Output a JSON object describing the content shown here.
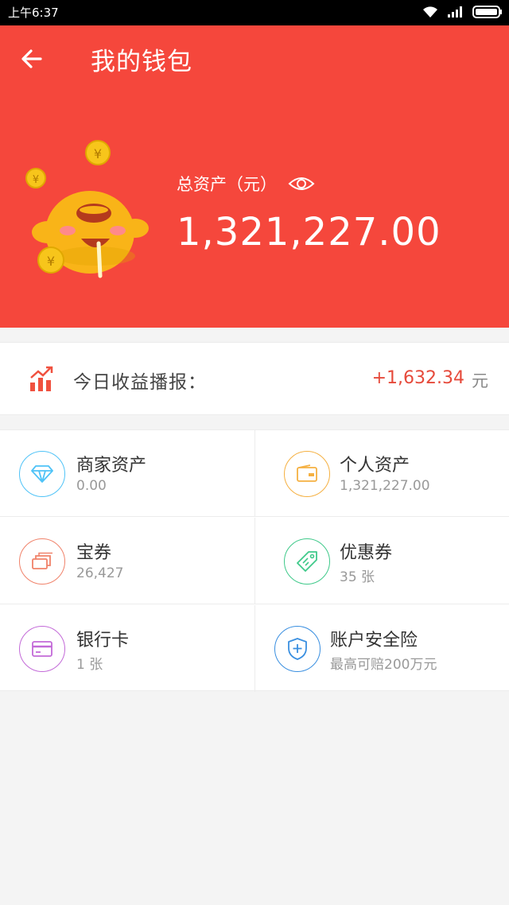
{
  "status_bar": {
    "time": "上午6:37"
  },
  "header": {
    "title": "我的钱包",
    "total_assets_label": "总资产（元）",
    "total_assets_value": "1,321,227.00"
  },
  "earnings": {
    "label": "今日收益播报：",
    "value": "+1,632.34",
    "unit": "元"
  },
  "grid": [
    {
      "title": "商家资产",
      "sub": "0.00"
    },
    {
      "title": "个人资产",
      "sub": "1,321,227.00"
    },
    {
      "title": "宝券",
      "sub": "26,427"
    },
    {
      "title": "优惠券",
      "sub": "35 张"
    },
    {
      "title": "银行卡",
      "sub": "1 张"
    },
    {
      "title": "账户安全险",
      "sub": "最高可赔200万元"
    }
  ],
  "icons": {
    "back": "back-arrow-icon",
    "eye": "eye-icon",
    "earnings": "chart-up-icon",
    "merchant": "diamond-icon",
    "personal": "wallet-icon",
    "coupon_treasure": "cards-stack-icon",
    "discount": "tag-icon",
    "bank_card": "credit-card-icon",
    "insurance": "shield-plus-icon"
  },
  "colors": {
    "header_bg": "#f5473c",
    "earnings_value": "#e64a3b",
    "merchant": "#4fc3f7",
    "personal": "#f5b041",
    "coupon_treasure": "#f0826a",
    "discount": "#3fc98a",
    "bank_card": "#c36ad8",
    "insurance": "#3a8fe0"
  }
}
